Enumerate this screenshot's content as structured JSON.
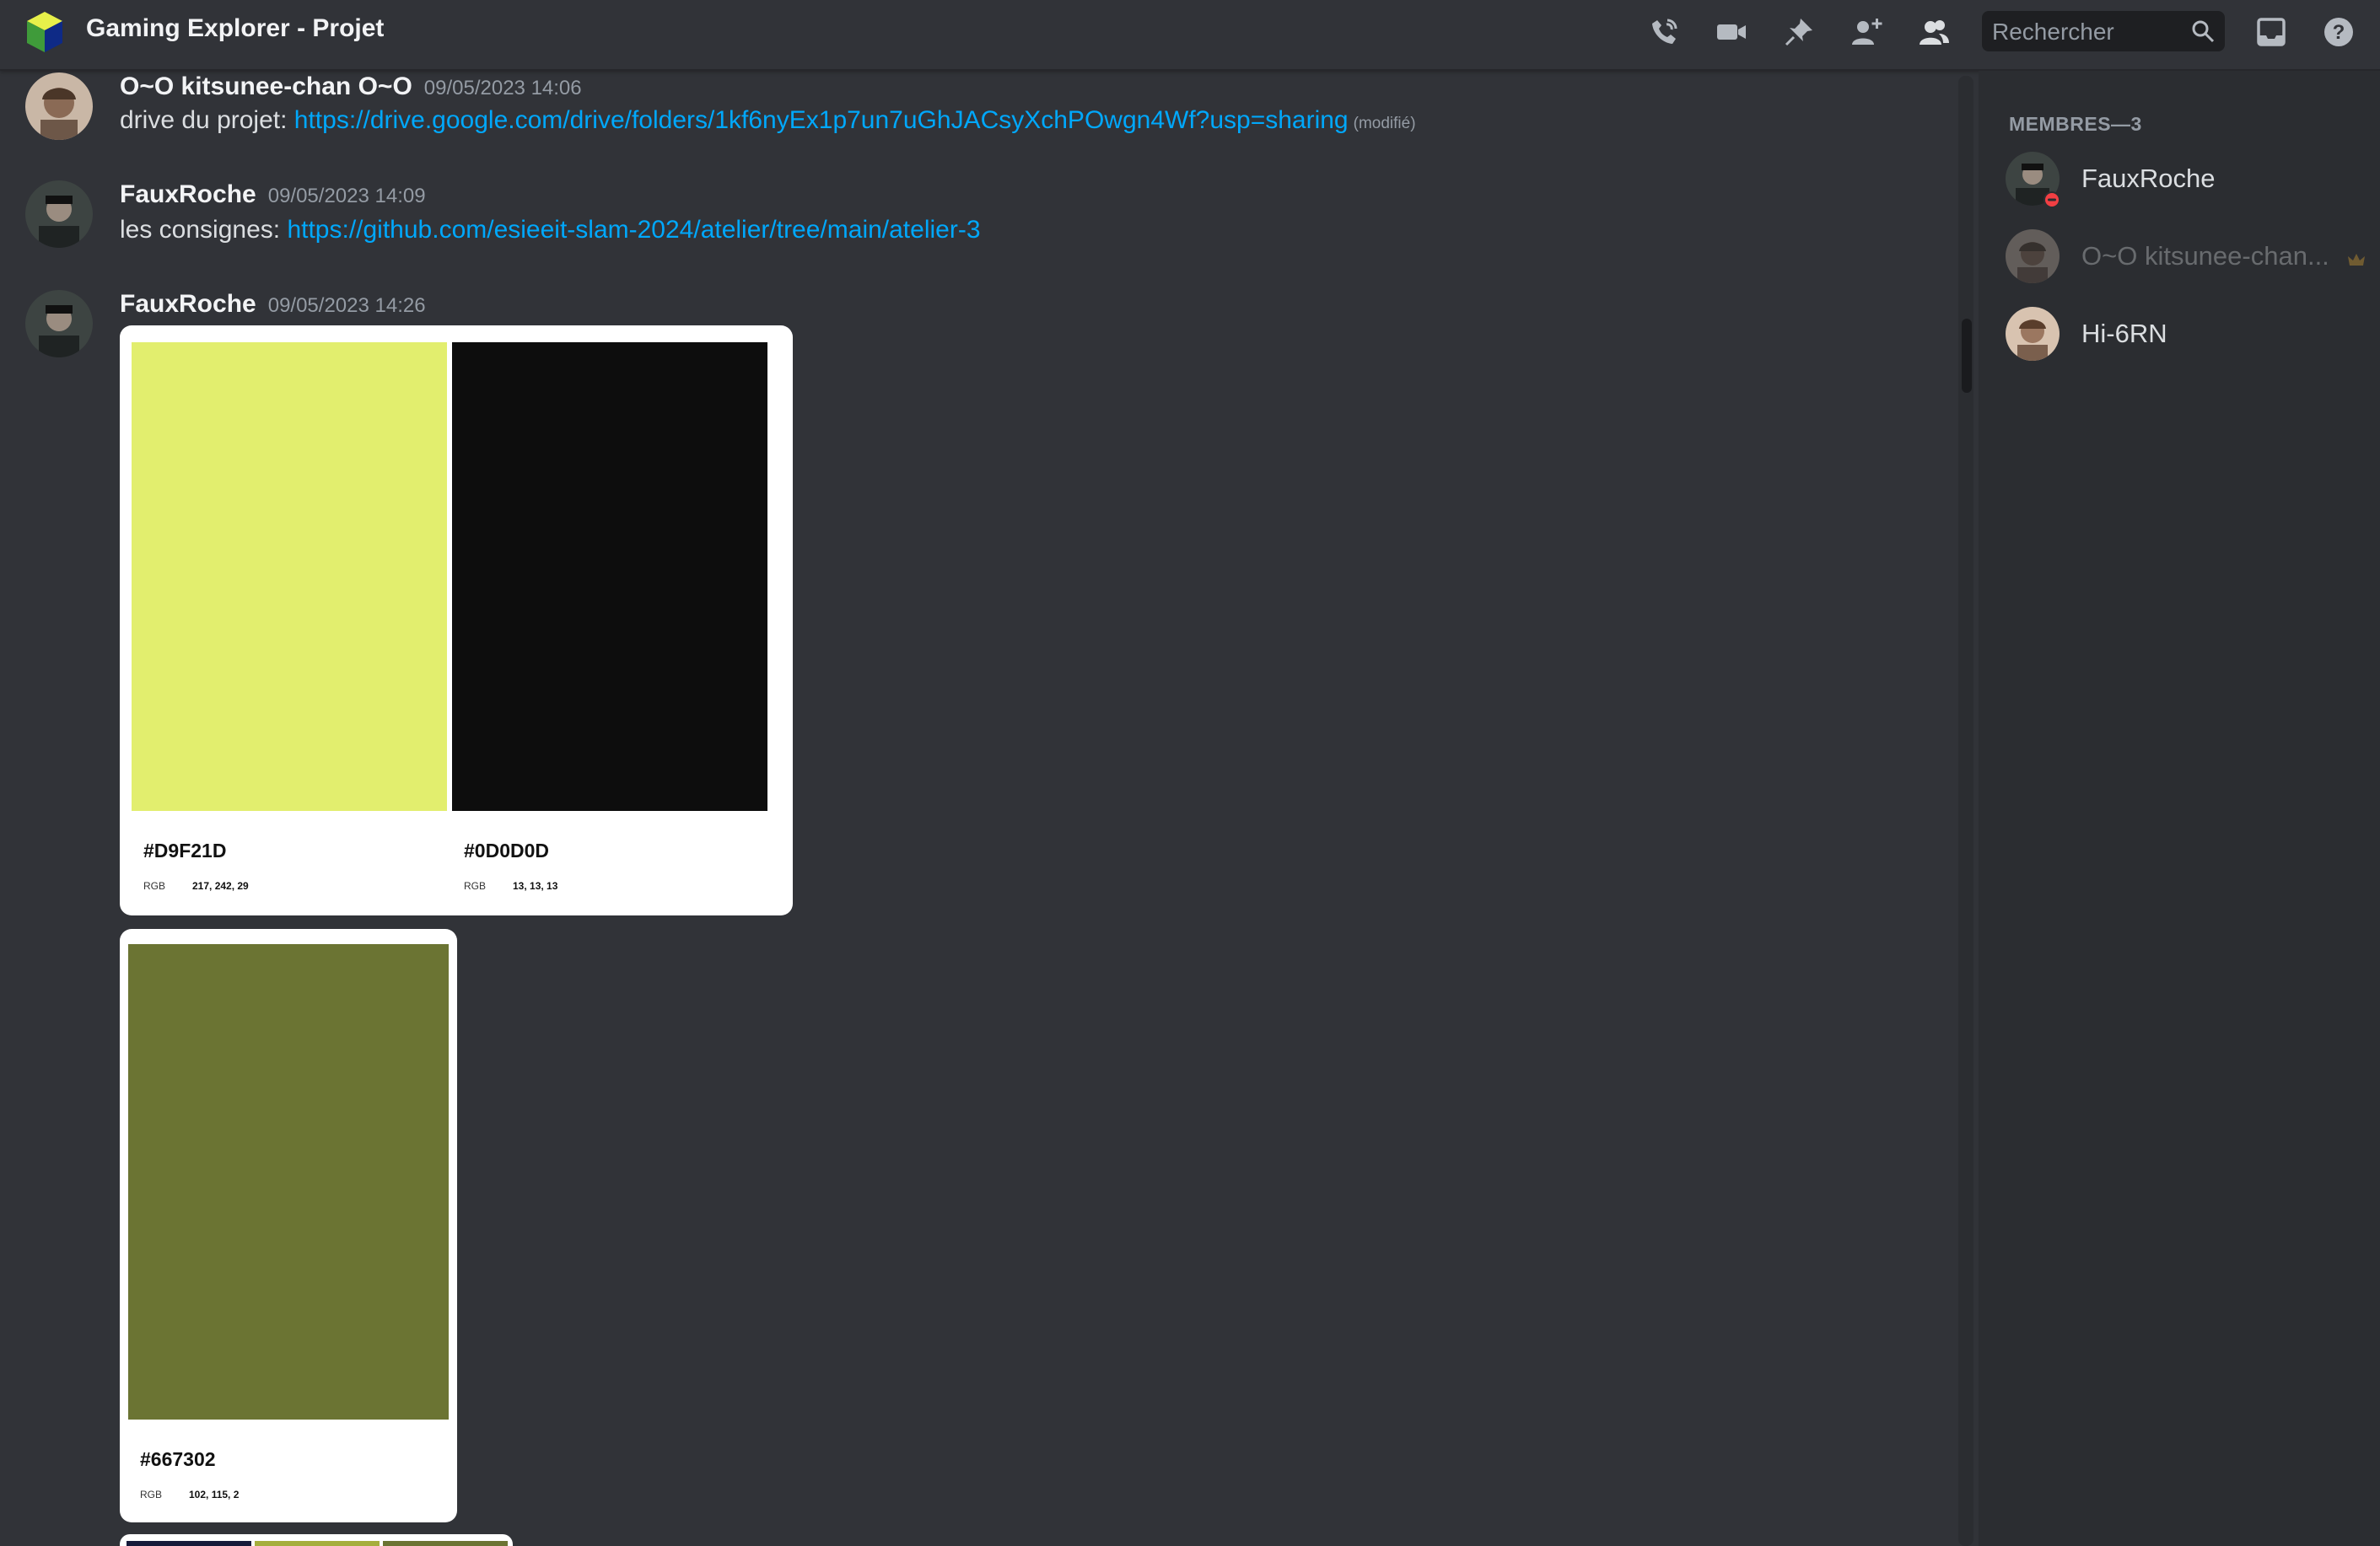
{
  "header": {
    "channel_title": "Gaming Explorer - Projet",
    "search_placeholder": "Rechercher",
    "icons": [
      "phone-call-icon",
      "video-icon",
      "pin-icon",
      "add-member-icon",
      "members-icon",
      "search-icon",
      "inbox-icon",
      "help-icon"
    ]
  },
  "messages": [
    {
      "author": "O~O kitsunee-chan O~O",
      "timestamp": "09/05/2023 14:06",
      "text_prefix": "drive du projet: ",
      "link": "https://drive.google.com/drive/folders/1kf6nyEx1p7un7uGhJACsyXchPOwgn4Wf?usp=sharing",
      "edited": "(modifié)"
    },
    {
      "author": "FauxRoche",
      "timestamp": "09/05/2023 14:09",
      "text_prefix": "les consignes: ",
      "link": "https://github.com/esieeit-slam-2024/atelier/tree/main/atelier-3"
    },
    {
      "author": "FauxRoche",
      "timestamp": "09/05/2023 14:26",
      "attachments": [
        {
          "swatches": [
            {
              "hex": "#D9F21D",
              "rgb_label": "RGB",
              "rgb": "217, 242, 29",
              "color": "#e2ee6e"
            },
            {
              "hex": "#0D0D0D",
              "rgb_label": "RGB",
              "rgb": "13, 13, 13",
              "color": "#0d0d0d"
            }
          ]
        },
        {
          "swatches": [
            {
              "hex": "#667302",
              "rgb_label": "RGB",
              "rgb": "102, 115, 2",
              "color": "#6b7433"
            }
          ]
        }
      ]
    }
  ],
  "members": {
    "title": "MEMBRES—3",
    "list": [
      {
        "name": "FauxRoche",
        "status": "dnd"
      },
      {
        "name": "O~O kitsunee-chan...",
        "status": "offline",
        "owner": true
      },
      {
        "name": "Hi-6RN",
        "status": "online"
      }
    ]
  },
  "colors": {
    "background": "#313338",
    "sidebar": "#2b2d31",
    "link": "#00a8fc",
    "dnd": "#f23f43"
  }
}
